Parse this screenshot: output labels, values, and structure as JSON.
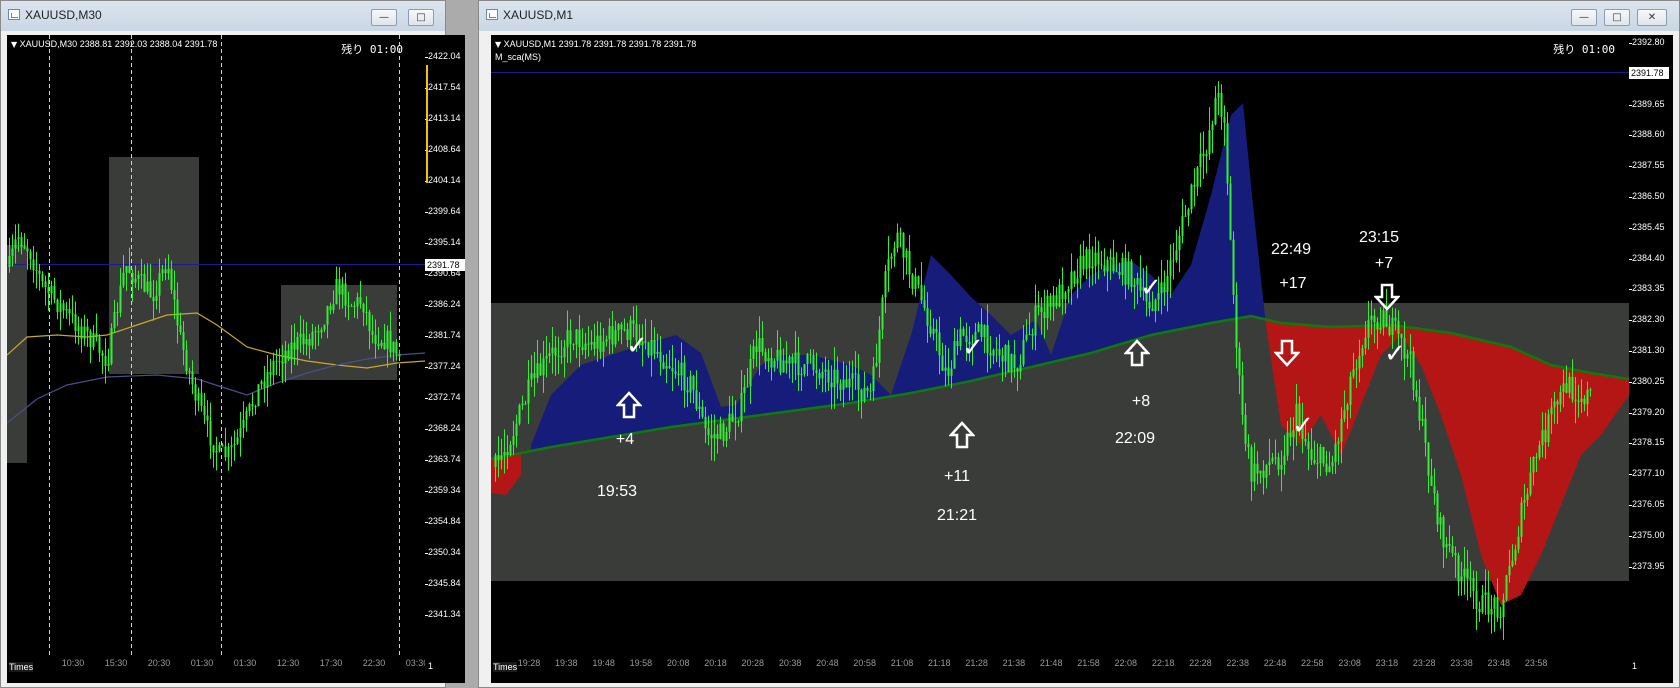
{
  "colors": {
    "candle": "#33ee33",
    "blue_cloud": "#161c7a",
    "red_cloud": "#b41616",
    "base_line": "#0e7a0e",
    "box": "#3a3c3a",
    "ma1": "#c8a72c",
    "ma2": "#4a4f8a",
    "priceline": "#1c1c8c"
  },
  "left": {
    "title": "XAUUSD,M30",
    "buttons": [
      "minimize",
      "maximize",
      "close"
    ],
    "info": "XAUUSD,M30  2388.81 2392.03 2388.04 2391.78",
    "remaining": "残り 01:00",
    "yticks": [
      "2422.04",
      "2417.54",
      "2413.14",
      "2408.64",
      "2404.14",
      "2399.64",
      "2395.14",
      "2390.64",
      "2386.24",
      "2381.74",
      "2377.24",
      "2372.74",
      "2368.24",
      "2363.74",
      "2359.34",
      "2354.84",
      "2350.34",
      "2345.84",
      "2341.34"
    ],
    "current_price": "2391.78",
    "xlabels": [
      "10:30",
      "15:30",
      "20:30",
      "01:30",
      "01:30",
      "12:30",
      "17:30",
      "22:30",
      "03:30"
    ],
    "times_label": "Times",
    "corner": "1"
  },
  "right": {
    "title": "XAUUSD,M1",
    "buttons": [
      "minimize",
      "maximize",
      "close"
    ],
    "info": "XAUUSD,M1  2391.78 2391.78 2391.78 2391.78",
    "indicator": "M_sca(MS)",
    "remaining": "残り 01:00",
    "yticks": [
      "2392.80",
      "2390.70",
      "2389.65",
      "2388.60",
      "2387.55",
      "2386.50",
      "2385.45",
      "2384.40",
      "2383.35",
      "2382.30",
      "2381.30",
      "2380.25",
      "2379.20",
      "2378.15",
      "2377.10",
      "2376.05",
      "2375.00",
      "2373.95"
    ],
    "current_price": "2391.78",
    "xlabels": [
      "19:28",
      "19:38",
      "19:48",
      "19:58",
      "20:08",
      "20:18",
      "20:28",
      "20:38",
      "20:48",
      "20:58",
      "21:08",
      "21:18",
      "21:28",
      "21:38",
      "21:48",
      "21:58",
      "22:08",
      "22:18",
      "22:28",
      "22:38",
      "22:48",
      "22:58",
      "23:08",
      "23:18",
      "23:28",
      "23:38",
      "23:48",
      "23:58"
    ],
    "times_label": "Times",
    "corner": "1",
    "annotations": {
      "t1": {
        "points": "+4",
        "time": "19:53"
      },
      "t2": {
        "points": "+11",
        "time": "21:21"
      },
      "t3": {
        "points": "+8",
        "time": "22:09"
      },
      "t4": {
        "time": "22:49",
        "points": "+17"
      },
      "t5": {
        "time": "23:15",
        "points": "+7"
      }
    }
  }
}
